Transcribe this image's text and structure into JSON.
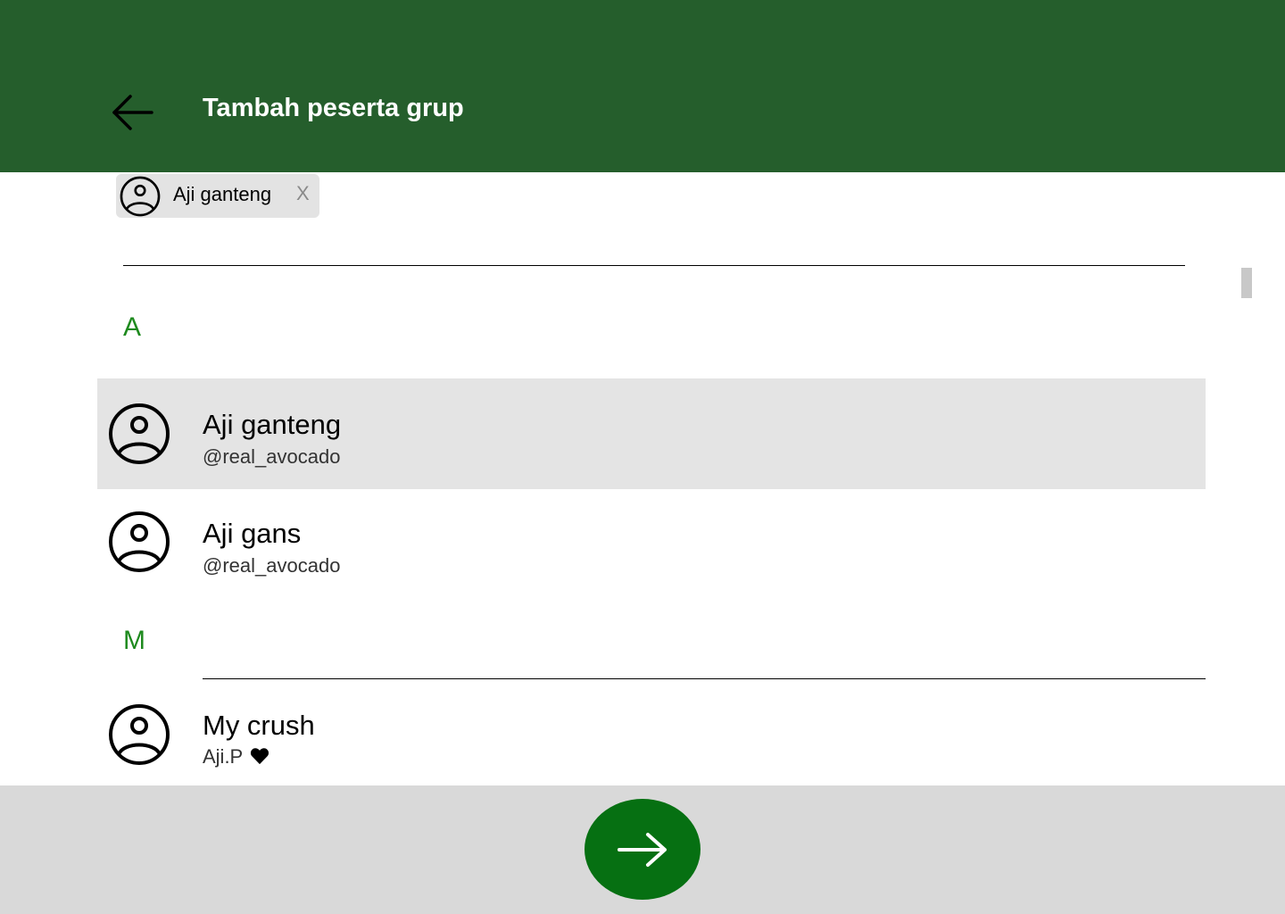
{
  "header": {
    "title": "Tambah peserta grup",
    "back_icon": "arrow-left-icon",
    "background_color": "#255e2c"
  },
  "selected_chips": [
    {
      "name": "Aji ganteng",
      "remove_label": "X"
    }
  ],
  "sections": [
    {
      "letter": "A",
      "contacts": [
        {
          "name": "Aji ganteng",
          "subtitle": "@real_avocado",
          "selected": true
        },
        {
          "name": "Aji gans",
          "subtitle": "@real_avocado",
          "selected": false
        }
      ]
    },
    {
      "letter": "M",
      "contacts": [
        {
          "name": "My crush",
          "subtitle": "Aji.P",
          "subtitle_icon": "heart-icon",
          "selected": false
        }
      ]
    }
  ],
  "footer": {
    "next_icon": "arrow-right-icon",
    "button_color": "#067012"
  },
  "colors": {
    "accent_letter": "#1e8a1e",
    "selected_row": "#e4e4e4"
  }
}
